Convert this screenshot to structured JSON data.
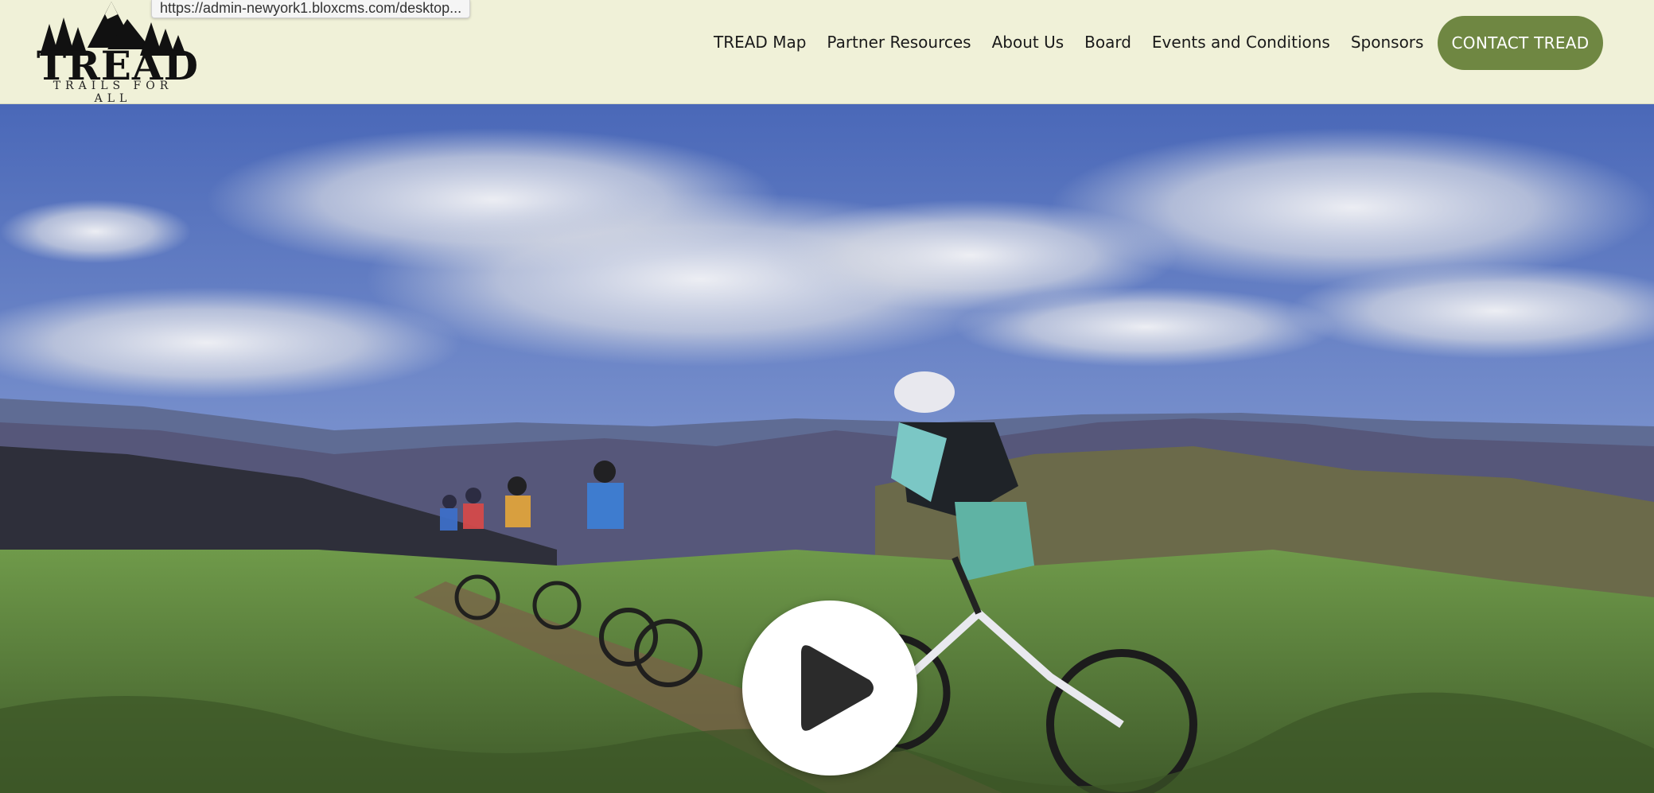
{
  "browser": {
    "status_url": "https://admin-newyork1.bloxcms.com/desktop..."
  },
  "header": {
    "logo_title": "TREAD",
    "logo_tagline": "TRAILS FOR ALL",
    "nav": [
      {
        "label": "TREAD Map"
      },
      {
        "label": "Partner Resources"
      },
      {
        "label": "About Us"
      },
      {
        "label": "Board"
      },
      {
        "label": "Events and Conditions"
      },
      {
        "label": "Sponsors"
      }
    ],
    "contact_label": "CONTACT TREAD"
  },
  "hero": {
    "media": "video",
    "play_icon": "play-icon"
  },
  "colors": {
    "header_bg": "#f0f1d8",
    "accent": "#6f8742"
  }
}
